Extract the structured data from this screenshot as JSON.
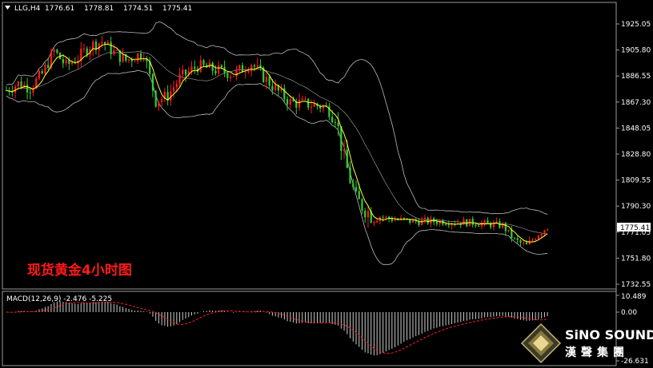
{
  "chart_data": [
    {
      "type": "candlestick",
      "symbol_label": "LLG,H4",
      "ohlc_header": [
        "1776.61",
        "1778.81",
        "1774.51",
        "1775.41"
      ],
      "annotation": "现货黄金4小时图",
      "ylim": [
        1732.55,
        1935.0
      ],
      "y_ticks": [
        "1925.05",
        "1905.80",
        "1886.55",
        "1867.30",
        "1848.05",
        "1828.80",
        "1809.55",
        "1790.30",
        "1771.05",
        "1751.80",
        "1732.55"
      ],
      "current_price": "1775.41",
      "overlays": [
        "Bollinger Bands",
        "Moving Average"
      ],
      "colors": {
        "bullish": "#ff1a1a",
        "bearish": "#33cc33",
        "bands": "#bbbbbb",
        "ma": "#ffff33"
      },
      "price_path": [
        [
          0,
          1876
        ],
        [
          4,
          1881
        ],
        [
          8,
          1878
        ],
        [
          12,
          1888
        ],
        [
          16,
          1905
        ],
        [
          20,
          1894
        ],
        [
          24,
          1900
        ],
        [
          28,
          1909
        ],
        [
          32,
          1912
        ],
        [
          36,
          1904
        ],
        [
          40,
          1898
        ],
        [
          46,
          1904
        ],
        [
          50,
          1868
        ],
        [
          54,
          1872
        ],
        [
          58,
          1885
        ],
        [
          64,
          1894
        ],
        [
          70,
          1891
        ],
        [
          76,
          1888
        ],
        [
          82,
          1896
        ],
        [
          86,
          1886
        ],
        [
          90,
          1877
        ],
        [
          95,
          1867
        ],
        [
          100,
          1866
        ],
        [
          106,
          1864
        ],
        [
          110,
          1858
        ],
        [
          113,
          1825
        ],
        [
          117,
          1795
        ],
        [
          122,
          1784
        ],
        [
          128,
          1781
        ],
        [
          136,
          1779
        ],
        [
          146,
          1779
        ],
        [
          156,
          1778
        ],
        [
          166,
          1776
        ],
        [
          170,
          1765
        ],
        [
          174,
          1761
        ],
        [
          178,
          1770
        ],
        [
          181,
          1775
        ]
      ]
    },
    {
      "type": "macd",
      "label": "MACD(12,26,9) -2.476 -5.225",
      "ylim": [
        -26.631,
        10.489
      ],
      "y_ticks": [
        "10.489",
        "0.00",
        "-26.631"
      ],
      "colors": {
        "histogram": "#cccccc",
        "signal": "#ff2020"
      }
    }
  ],
  "brand": {
    "name_en": "SiNO SOUND",
    "name_zh": "漢聲集團"
  }
}
